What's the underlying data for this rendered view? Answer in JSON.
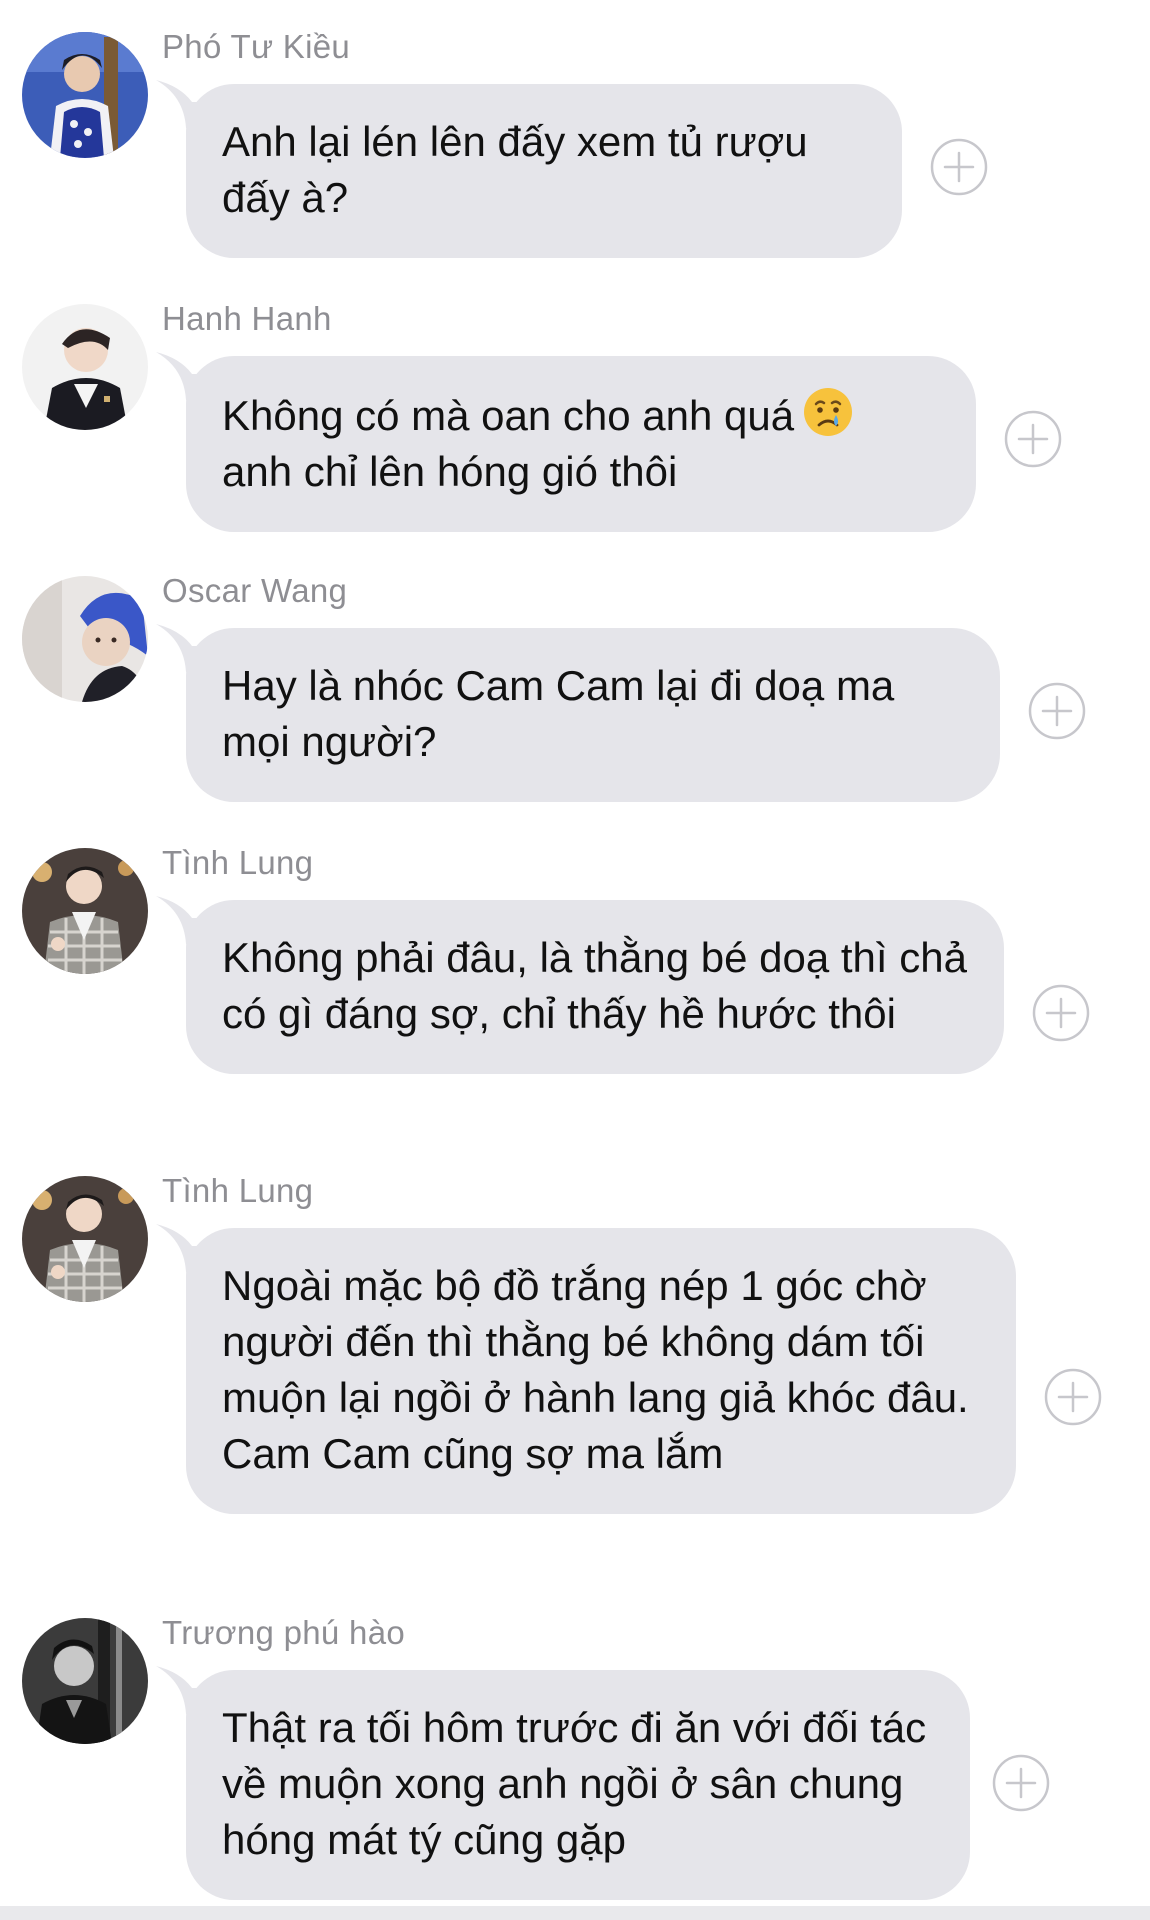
{
  "messages": [
    {
      "sender": "Phó Tư Kiều",
      "text": "Anh lại lén lên đấy xem tủ rượu đấy à?",
      "avatar": "avatar-young-man-blue-vest"
    },
    {
      "sender": "Hanh Hanh",
      "text": "Không có mà oan cho anh quá",
      "text2": "anh chỉ lên hóng gió thôi",
      "emoji": "crying-face-emoji",
      "avatar": "avatar-young-man-dark-jacket"
    },
    {
      "sender": "Oscar Wang",
      "text": "Hay là nhóc Cam Cam lại đi doạ ma mọi người?",
      "avatar": "avatar-blue-hair-selfie"
    },
    {
      "sender": "Tình Lung",
      "text": "Không phải đâu, là thằng bé doạ thì chả có gì đáng sợ, chỉ thấy hề hước thôi",
      "avatar": "avatar-young-man-checkered-shirt"
    },
    {
      "sender": "Tình Lung",
      "text": "Ngoài mặc bộ đồ trắng nép 1 góc chờ người đến thì thằng bé không dám tối muộn lại ngồi ở hành lang giả khóc đâu. Cam Cam cũng sợ ma lắm",
      "avatar": "avatar-young-man-checkered-shirt"
    },
    {
      "sender": "Trương phú hào",
      "text": "Thật ra tối hôm trước đi ăn với đối tác về muộn xong anh ngồi ở sân chung hóng mát tý cũng gặp",
      "avatar": "avatar-monochrome-portrait"
    }
  ],
  "colors": {
    "bubble": "#e5e5ea",
    "sender_name": "#8e8e93",
    "message_text": "#111111",
    "reaction_icon": "#c7c7cc"
  },
  "icons": {
    "reaction": "add-reaction-icon"
  }
}
